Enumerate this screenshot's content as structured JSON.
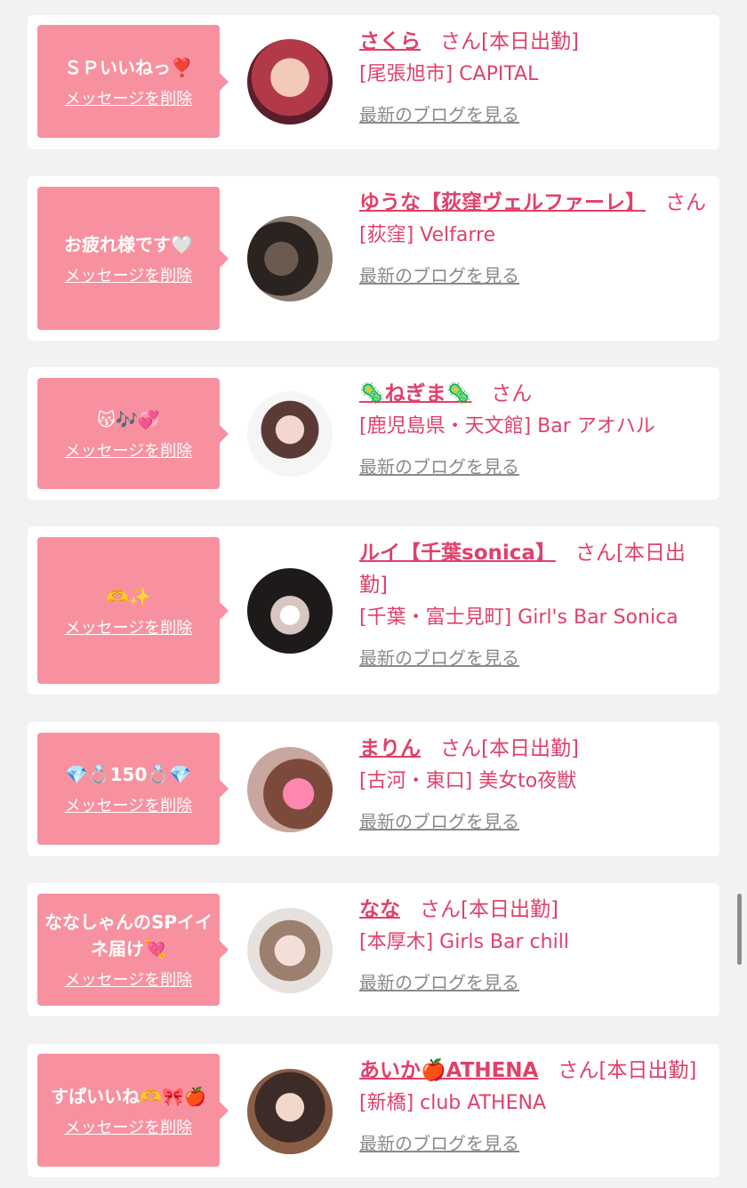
{
  "delete_label": "メッセージを削除",
  "blog_label": "最新のブログを見る",
  "colors": {
    "accent": "#e0406a",
    "bubble": "#f8919f",
    "background": "#f2f2f2"
  },
  "items": [
    {
      "message": "ＳＰいいねっ❣️",
      "cast": "さくら",
      "suffix": "さん[本日出勤]",
      "shop": "[尾張旭市] CAPITAL"
    },
    {
      "message": "お疲れ様です🤍",
      "cast": "ゆうな【荻窪ヴェルファーレ】",
      "suffix": "さん",
      "shop": "[荻窪] Velfarre"
    },
    {
      "message": "😽🎶💞",
      "cast": "🦠ねぎま🦠",
      "suffix": "さん",
      "shop": "[鹿児島県・天文館] Bar アオハル"
    },
    {
      "message": "🫶✨",
      "cast": "ルイ【千葉sonica】",
      "suffix": "さん[本日出勤]",
      "shop": "[千葉・富士見町] Girl's Bar Sonica"
    },
    {
      "message": "💎💍150💍💎",
      "cast": "まりん",
      "suffix": "さん[本日出勤]",
      "shop": "[古河・東口] 美女to夜獣"
    },
    {
      "message": "ななしゃんのSPイイネ届け💘",
      "cast": "なな",
      "suffix": "さん[本日出勤]",
      "shop": "[本厚木] Girls Bar chill"
    },
    {
      "message": "すぱいいね🫶🎀🍎",
      "cast": "あいか🍎ATHENA",
      "suffix": "さん[本日出勤]",
      "shop": "[新橋] club ATHENA"
    }
  ]
}
